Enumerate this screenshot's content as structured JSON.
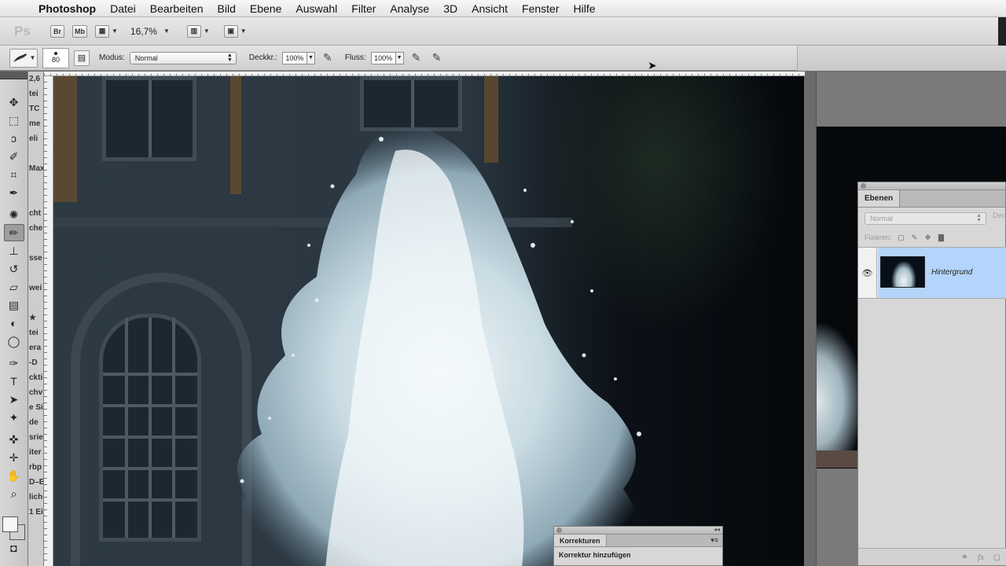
{
  "menubar": {
    "apple": "",
    "app_name": "Photoshop",
    "items": [
      "Datei",
      "Bearbeiten",
      "Bild",
      "Ebene",
      "Auswahl",
      "Filter",
      "Analyse",
      "3D",
      "Ansicht",
      "Fenster",
      "Hilfe"
    ]
  },
  "appbar": {
    "logo": "Ps",
    "bridge_label": "Br",
    "minibridge_label": "Mb",
    "zoom": "16,7%"
  },
  "options": {
    "brush_size": "80",
    "mode_label": "Modus:",
    "mode_value": "Normal",
    "opacity_label": "Deckkr.:",
    "opacity_value": "100%",
    "flow_label": "Fluss:",
    "flow_value": "100%"
  },
  "strip": {
    "items": [
      "2,6",
      "tei",
      "TC",
      "me",
      "eli",
      "",
      "Max",
      "",
      "",
      "cht",
      "che",
      "",
      "sse",
      "",
      "wei",
      "",
      "★",
      "tei",
      "era",
      "-D",
      "ckti",
      "chv",
      "e Si",
      "de",
      "srie",
      "iter",
      "rbp",
      "D–E",
      "lich",
      "1 Ei"
    ]
  },
  "layers_panel": {
    "tab": "Ebenen",
    "blend_mode": "Normal",
    "opacity_label": "Dec",
    "lock_label": "Fixieren:",
    "layer_name": "Hintergrund"
  },
  "corrections_panel": {
    "tab": "Korrekturen",
    "heading": "Korrektur hinzufügen"
  },
  "colors": {
    "selection": "#b4d5fb",
    "panel": "#d7d7d7",
    "canvas_dark": "#05080c"
  }
}
